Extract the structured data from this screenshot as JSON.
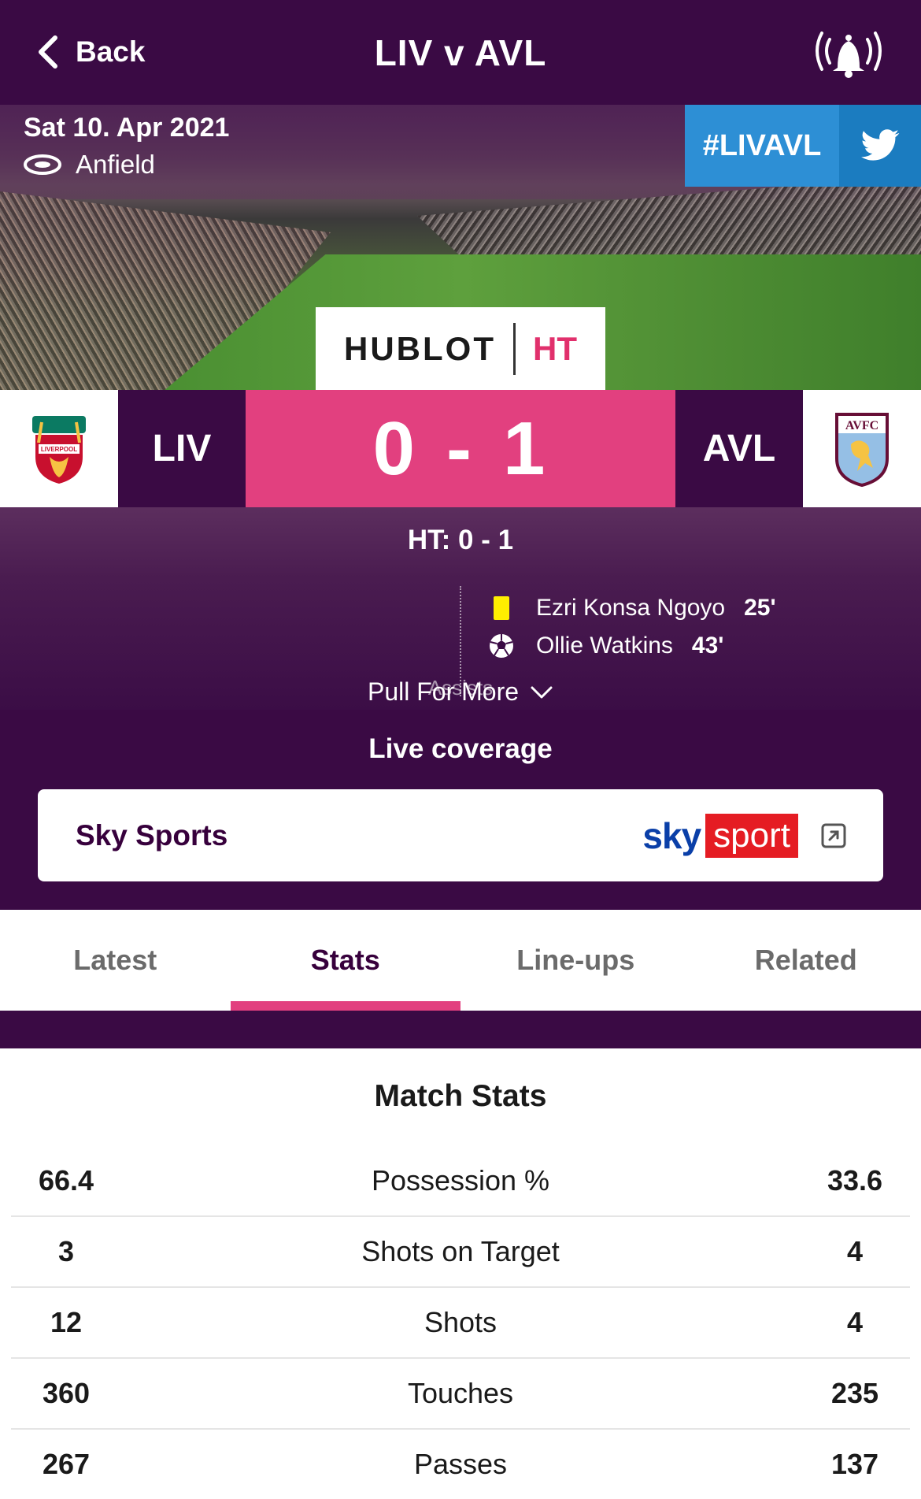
{
  "header": {
    "back_label": "Back",
    "title": "LIV v AVL",
    "bell_icon": "bell-alert-icon"
  },
  "match": {
    "date": "Sat 10. Apr 2021",
    "venue": "Anfield",
    "hashtag": "#LIVAVL",
    "sponsor": "HUBLOT",
    "status": "HT",
    "home_abbr": "LIV",
    "away_abbr": "AVL",
    "home_score": "0",
    "away_score": "1",
    "score_separator": "-",
    "halftime": "HT: 0 - 1",
    "home_crest_text": "LIVERPOOL",
    "away_crest_text": "AVFC"
  },
  "events": [
    {
      "type": "yellow-card",
      "player": "Ezri Konsa Ngoyo",
      "minute": "25'"
    },
    {
      "type": "goal",
      "player": "Ollie Watkins",
      "minute": "43'"
    }
  ],
  "assists_label": "Assists",
  "pull_label": "Pull For More",
  "live": {
    "title": "Live coverage",
    "broadcaster": "Sky Sports",
    "logo_sky": "sky",
    "logo_sport": "sport"
  },
  "tabs": [
    "Latest",
    "Stats",
    "Line-ups",
    "Related"
  ],
  "active_tab": "Stats",
  "stats": {
    "title": "Match Stats",
    "rows": [
      {
        "home": "66.4",
        "label": "Possession %",
        "away": "33.6"
      },
      {
        "home": "3",
        "label": "Shots on Target",
        "away": "4"
      },
      {
        "home": "12",
        "label": "Shots",
        "away": "4"
      },
      {
        "home": "360",
        "label": "Touches",
        "away": "235"
      },
      {
        "home": "267",
        "label": "Passes",
        "away": "137"
      }
    ]
  },
  "colors": {
    "brand_purple": "#3a0a44",
    "accent_pink": "#e2407f",
    "twitter_blue": "#2d8fd5",
    "yellow_card": "#ffee00"
  }
}
